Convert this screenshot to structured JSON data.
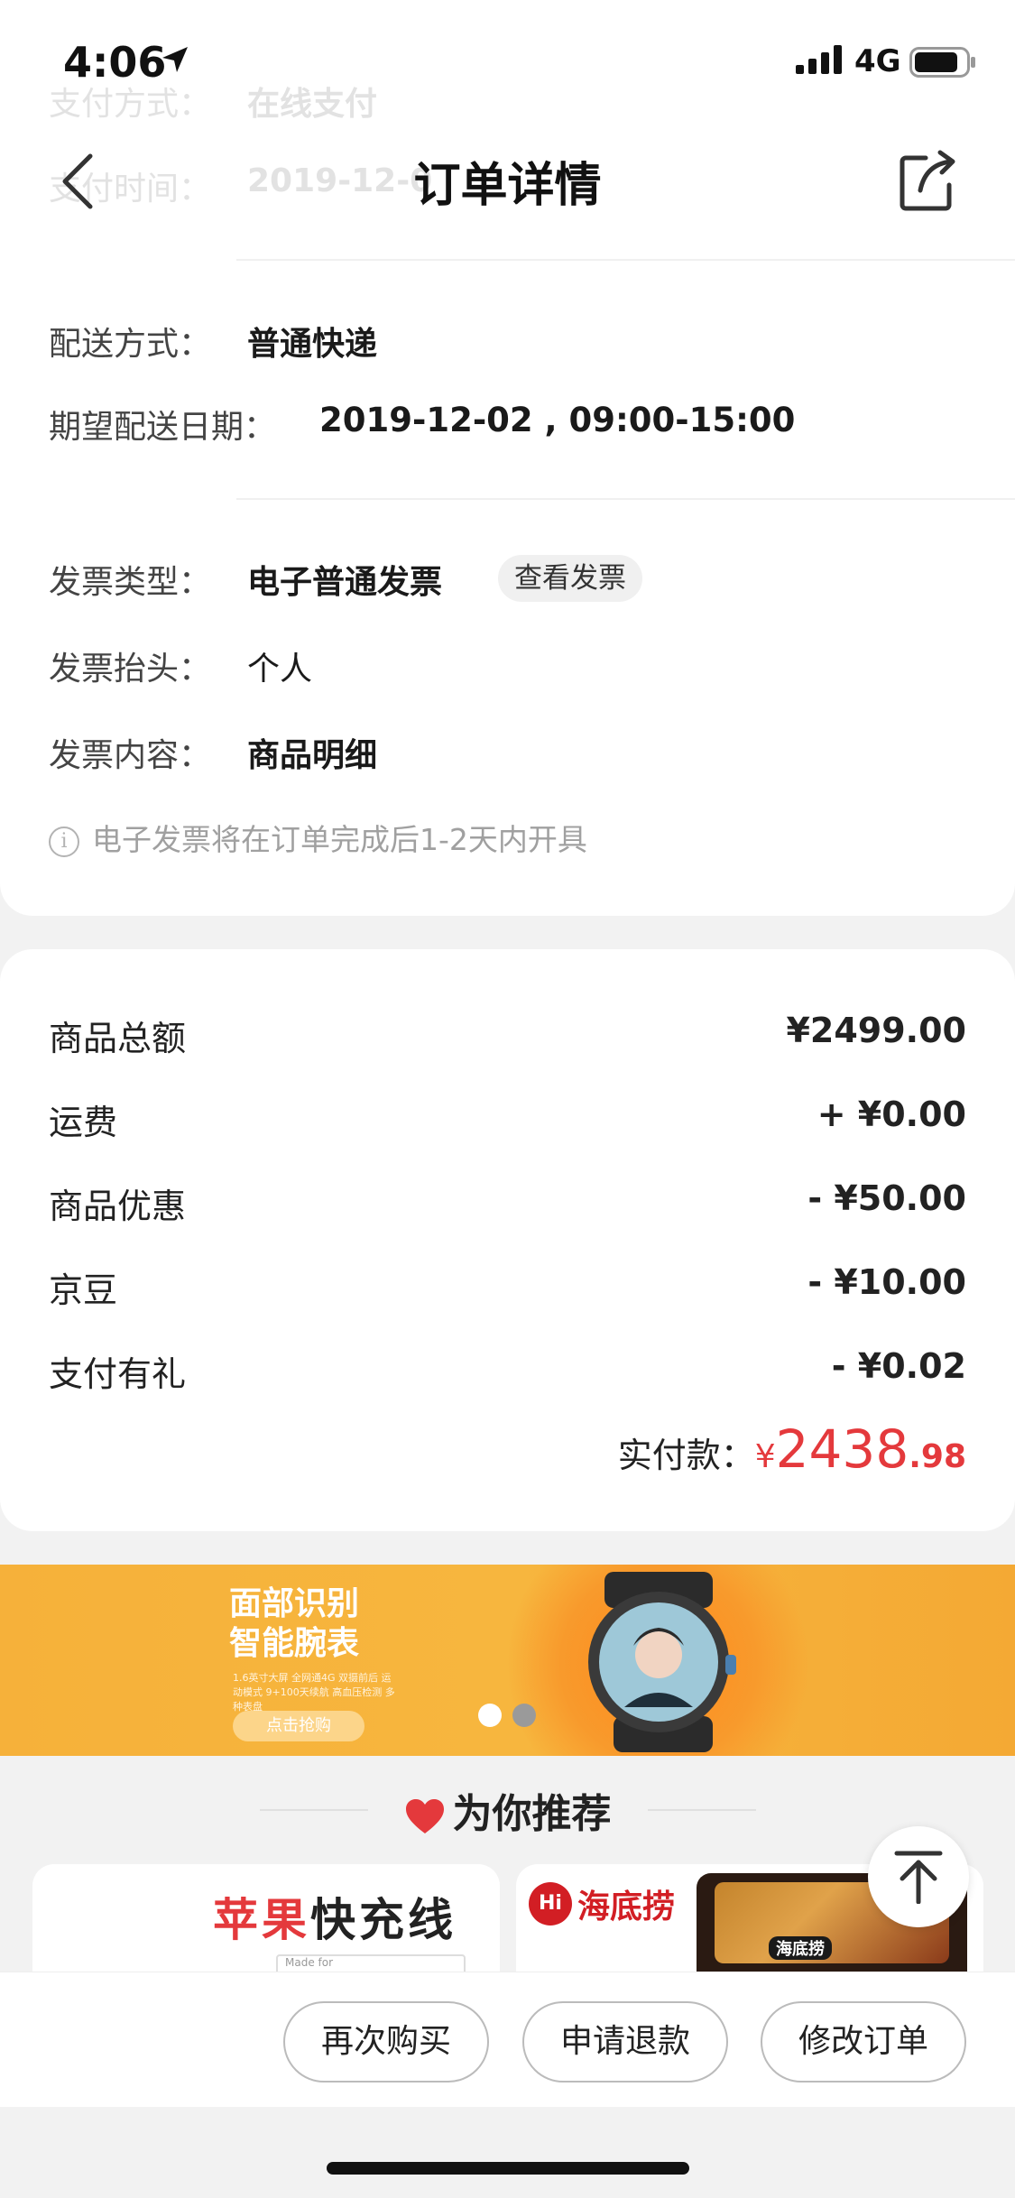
{
  "status_bar": {
    "time": "4:06",
    "network": "4G"
  },
  "nav": {
    "title": "订单详情"
  },
  "scrolled_rows": [
    {
      "label": "支付方式：",
      "value": "在线支付"
    },
    {
      "label": "支付时间：",
      "value": "2019-12-0"
    }
  ],
  "delivery": {
    "method_label": "配送方式：",
    "method_value": "普通快递",
    "date_label": "期望配送日期：",
    "date_value": "2019-12-02 , 09:00-15:00"
  },
  "invoice": {
    "type_label": "发票类型：",
    "type_value": "电子普通发票",
    "view_button": "查看发票",
    "title_label": "发票抬头：",
    "title_value": "个人",
    "content_label": "发票内容：",
    "content_value": "商品明细",
    "note": "电子发票将在订单完成后1-2天内开具"
  },
  "amounts": [
    {
      "label": "商品总额",
      "value": "¥2499.00"
    },
    {
      "label": "运费",
      "value": "+ ¥0.00"
    },
    {
      "label": "商品优惠",
      "value": "- ¥50.00"
    },
    {
      "label": "京豆",
      "value": "- ¥10.00"
    },
    {
      "label": "支付有礼",
      "value": "- ¥0.02"
    }
  ],
  "paid": {
    "label": "实付款：",
    "symbol": "¥",
    "integer": "2438",
    "decimal": ".98"
  },
  "banner": {
    "title_line1": "面部识别",
    "title_line2": "智能腕表",
    "desc": "1.6英寸大屏 全网通4G 双摄前后 运动模式 9+100天续航 高血压检测 多种表盘",
    "cta": "点击抢购",
    "active_dot": 0
  },
  "recommend": {
    "title": "为你推荐",
    "tile1_red": "苹果",
    "tile1_black": "快充线",
    "tile1_madefor": "Made for",
    "tile2_logo_mark": "Hi",
    "tile2_brand": "海底捞",
    "tile2_badge": "海底捞"
  },
  "bottom_buttons": [
    "再次购买",
    "申请退款",
    "修改订单"
  ],
  "colors": {
    "price_red": "#e4393c",
    "banner_orange": "#f6b13a"
  }
}
